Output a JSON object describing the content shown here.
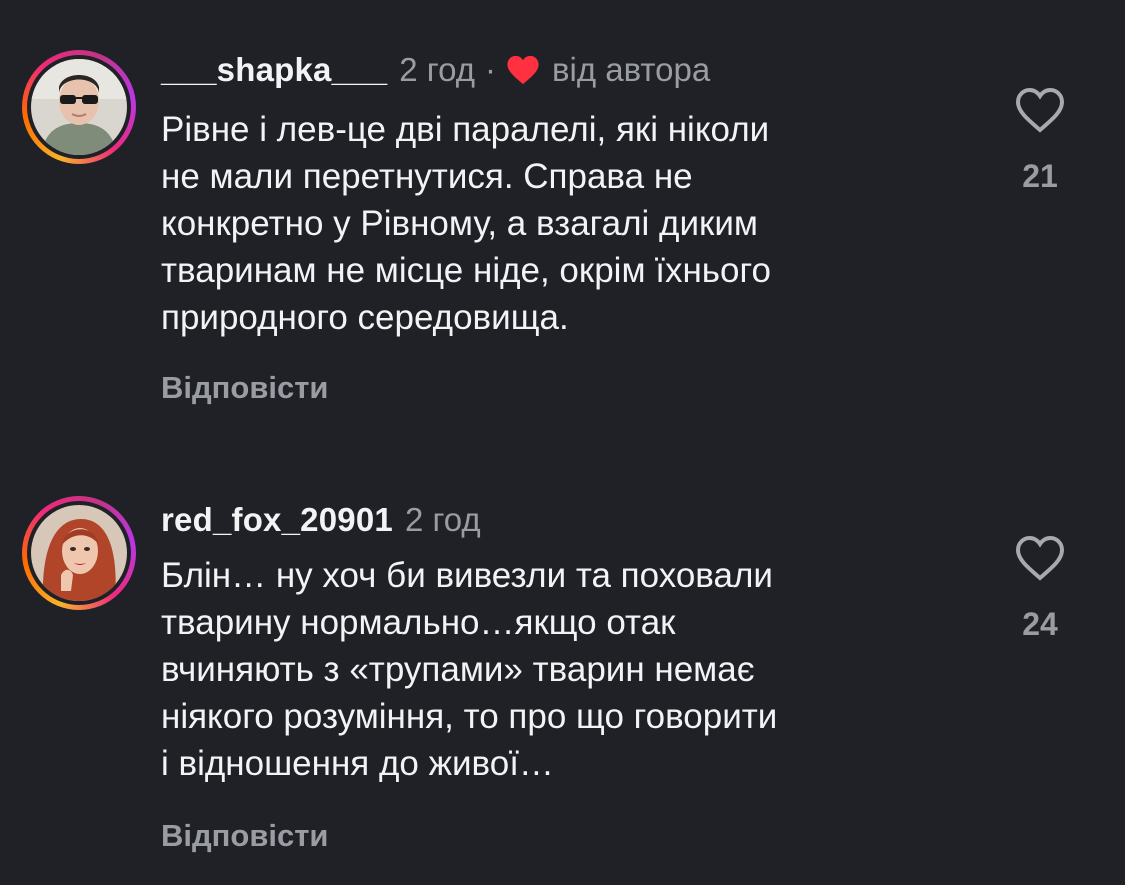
{
  "comments": [
    {
      "username": "___shapka___",
      "time": "2 год",
      "separator": "·",
      "author_liked_label": "від автора",
      "text": "Рівне і лев-це дві паралелі, які ніколи\nне мали перетнутися. Справа не\nконкретно у Рівному, а взагалі диким\nтваринам не місце ніде, окрім їхнього\nприродного середовища.",
      "reply_label": "Відповісти",
      "likes": "21",
      "avatar_icon": "avatar-man-sunglasses"
    },
    {
      "username": "red_fox_20901",
      "time": "2 год",
      "text": "Блін… ну хоч би вивезли та поховали\nтварину нормально…якщо отак\nвчиняють з «трупами» тварин немає\nніякого розуміння, то про що говорити\nі відношення до живої…",
      "reply_label": "Відповісти",
      "likes": "24",
      "avatar_icon": "avatar-woman-red-hair"
    }
  ],
  "colors": {
    "background": "#1f2126",
    "text_primary": "#f2f3f5",
    "text_secondary": "#9a9ca3",
    "author_heart": "#ff3040"
  }
}
